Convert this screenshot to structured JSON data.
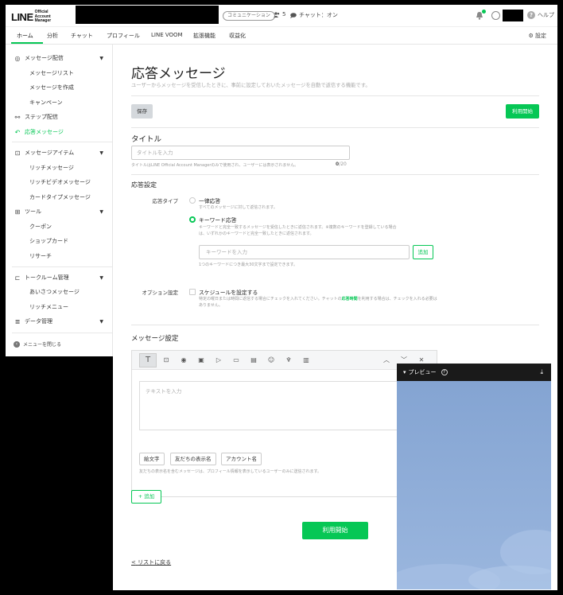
{
  "header": {
    "logo_main": "LINE",
    "logo_sub": "Official Account Manager",
    "community_badge": "コミュニケーション",
    "friend_count": "5",
    "chat_status": "チャット：オン",
    "help_label": "ヘルプ",
    "help_icon_text": "?"
  },
  "nav": {
    "tabs": [
      {
        "label": "ホーム"
      },
      {
        "label": "分析"
      },
      {
        "label": "チャット"
      },
      {
        "label": "プロフィール"
      },
      {
        "label": "LINE VOOM"
      },
      {
        "label": "拡張機能"
      },
      {
        "label": "収益化"
      }
    ],
    "settings_label": "設定"
  },
  "sidebar": {
    "items": [
      {
        "label": "メッセージ配信",
        "icon": "broadcast-icon"
      },
      {
        "label": "メッセージリスト"
      },
      {
        "label": "メッセージを作成"
      },
      {
        "label": "キャンペーン"
      },
      {
        "label": "ステップ配信",
        "icon": "step-icon"
      },
      {
        "label": "応答メッセージ",
        "icon": "reply-icon"
      },
      {
        "label": "メッセージアイテム",
        "icon": "item-icon"
      },
      {
        "label": "リッチメッセージ"
      },
      {
        "label": "リッチビデオメッセージ"
      },
      {
        "label": "カードタイプメッセージ"
      },
      {
        "label": "ツール",
        "icon": "tools-icon"
      },
      {
        "label": "クーポン"
      },
      {
        "label": "ショップカード"
      },
      {
        "label": "リサーチ"
      },
      {
        "label": "トークルーム管理",
        "icon": "talkroom-icon"
      },
      {
        "label": "あいさつメッセージ"
      },
      {
        "label": "リッチメニュー"
      },
      {
        "label": "データ管理",
        "icon": "data-icon"
      }
    ],
    "close_label": "メニューを閉じる"
  },
  "main": {
    "title": "応答メッセージ",
    "description": "ユーザーからメッセージを受信したときに、事前に設定しておいたメッセージを自動で返信する機能です。",
    "save_label": "保存",
    "start_label": "利用開始",
    "title_section": {
      "heading": "タイトル",
      "placeholder": "タイトルを入力",
      "hint": "タイトルはLINE Official Account Managerのみで使用され、ユーザーには表示されません。",
      "count": "0",
      "max": "/20"
    },
    "reply_settings": {
      "heading": "応答設定",
      "type_label": "応答タイプ",
      "option_all": "一律応答",
      "option_all_desc": "すべてのメッセージに対して返信されます。",
      "option_keyword": "キーワード応答",
      "option_keyword_desc_1": "キーワードと完全一致するメッセージを受信したときに返信されます。※複数のキーワードを登録している場合",
      "option_keyword_desc_2": "は、いずれかのキーワードと完全一致したときに返信されます。",
      "keyword_placeholder": "キーワードを入力",
      "keyword_add": "追加",
      "keyword_hint": "1つのキーワードにつき最大30文字まで設定できます。",
      "option_label": "オプション設定",
      "schedule_label": "スケジュールを設定する",
      "schedule_desc_1": "特定の曜日または時間に返信する場合にチェックを入れてください。チャットの",
      "schedule_desc_link": "応答時間",
      "schedule_desc_2": "を利用する場合は、チェックを入れる必要はありません。"
    },
    "message_settings": {
      "heading": "メッセージ設定",
      "text_placeholder": "テキストを入力",
      "chips": [
        "絵文字",
        "友だちの表示名",
        "アカウント名"
      ],
      "hint": "友だちの表示名を含むメッセージは、プロフィール情報を表示しているユーザーのみに送信されます。",
      "add_label": "+ 追加",
      "toolbar_text_tool": "T"
    },
    "start_bottom_label": "利用開始",
    "back_label": "リストに戻る"
  },
  "preview": {
    "title": "プレビュー",
    "help_icon_text": "?",
    "download_icon_text": "⤓",
    "background_color": "#8aaad6"
  },
  "colors": {
    "accent": "#06c755"
  }
}
